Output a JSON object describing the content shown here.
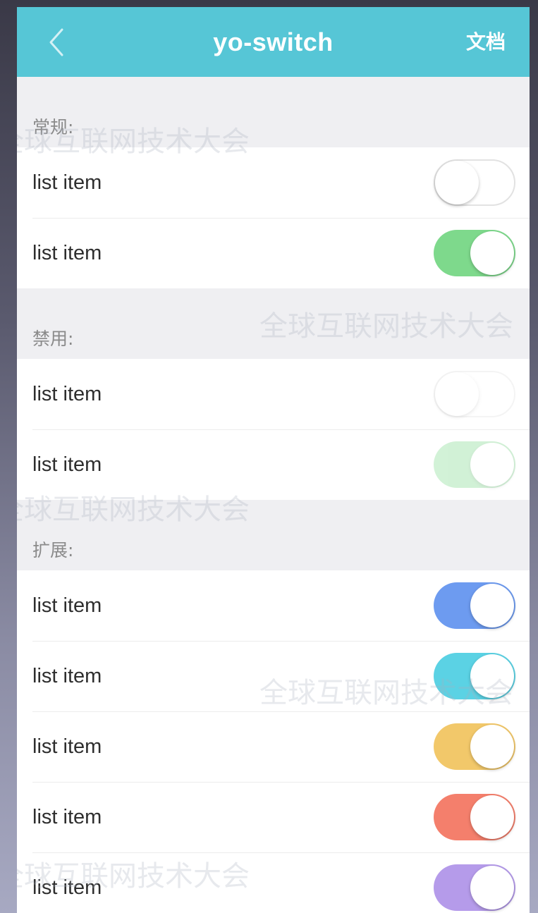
{
  "header": {
    "title": "yo-switch",
    "doc_label": "文档",
    "color": "#56c6d6"
  },
  "watermark": {
    "text": "全球互联网技术大会"
  },
  "sections": [
    {
      "heading": "常规:",
      "items": [
        {
          "label": "list item",
          "state": "off",
          "disabled": false,
          "color": "#ffffff"
        },
        {
          "label": "list item",
          "state": "on",
          "disabled": false,
          "color": "#7ed98c"
        }
      ]
    },
    {
      "heading": "禁用:",
      "items": [
        {
          "label": "list item",
          "state": "off",
          "disabled": true,
          "color": "#ffffff"
        },
        {
          "label": "list item",
          "state": "on",
          "disabled": true,
          "color": "#7ed98c"
        }
      ]
    },
    {
      "heading": "扩展:",
      "items": [
        {
          "label": "list item",
          "state": "on",
          "disabled": false,
          "color": "#6d9bf0"
        },
        {
          "label": "list item",
          "state": "on",
          "disabled": false,
          "color": "#5bd2e4"
        },
        {
          "label": "list item",
          "state": "on",
          "disabled": false,
          "color": "#f2c86a"
        },
        {
          "label": "list item",
          "state": "on",
          "disabled": false,
          "color": "#f47f6c"
        },
        {
          "label": "list item",
          "state": "on",
          "disabled": false,
          "color": "#b59bea"
        }
      ]
    }
  ]
}
